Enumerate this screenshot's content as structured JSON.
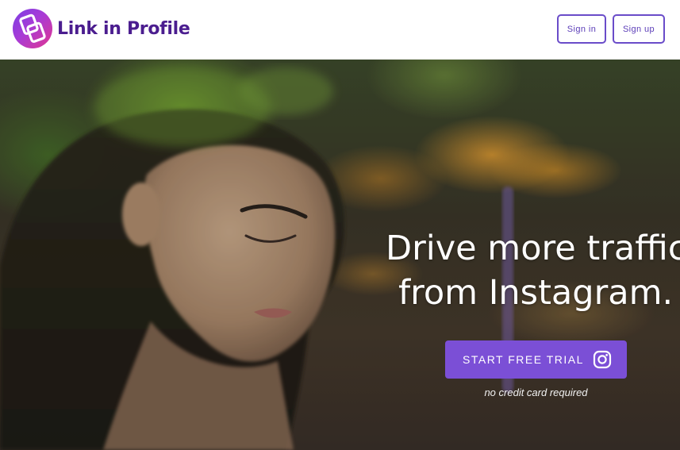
{
  "brand": {
    "name": "Link in Profile",
    "logo_icon": "linked-squares-icon",
    "colors": {
      "gradient_start": "#7b3fe4",
      "gradient_end": "#e0378f",
      "text": "#4b1d8f"
    }
  },
  "header": {
    "sign_in_label": "Sign in",
    "sign_up_label": "Sign up"
  },
  "hero": {
    "title_line1": "Drive more traffic",
    "title_line2": "from Instagram.",
    "cta_label": "START FREE TRIAL",
    "cta_icon": "instagram-icon",
    "cta_color": "#7b4fd6",
    "note": "no credit card required"
  }
}
